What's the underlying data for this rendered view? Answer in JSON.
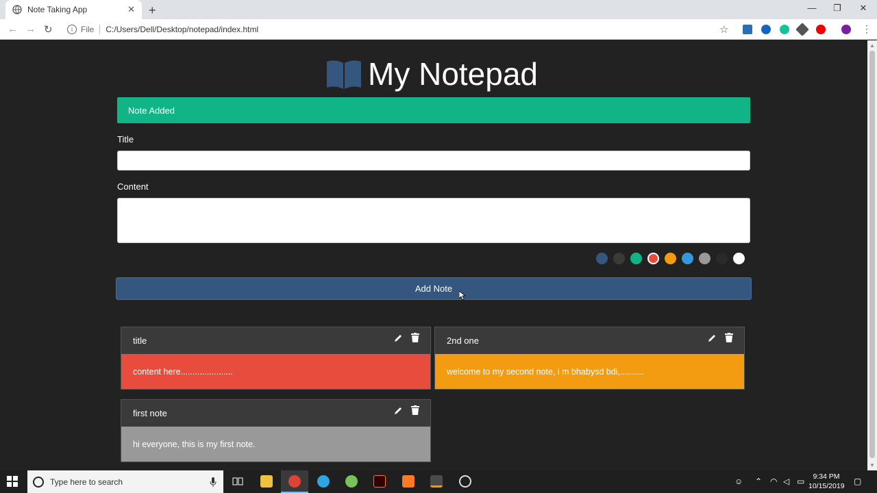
{
  "browser": {
    "tab_title": "Note Taking App",
    "tab_close": "✕",
    "new_tab": "+",
    "back": "←",
    "forward": "→",
    "reload": "↻",
    "info_glyph": "i",
    "file_label": "File",
    "url": "C:/Users/Dell/Desktop/notepad/index.html",
    "star": "☆",
    "menu": "⋮",
    "minimize": "—",
    "restore": "❐",
    "close": "✕"
  },
  "app": {
    "title": "My Notepad",
    "alert": "Note Added",
    "title_label": "Title",
    "content_label": "Content",
    "add_button": "Add Note",
    "colors": [
      "#34567f",
      "#3a3a3a",
      "#11b487",
      "#e74c3c",
      "#f39c12",
      "#3498db",
      "#999999",
      "#2a2a2a",
      "#ffffff"
    ],
    "selected_color": "#e74c3c"
  },
  "notes": [
    {
      "title": "title",
      "content": "content here......................",
      "color": "#e74c3c"
    },
    {
      "title": "2nd one",
      "content": "welcome to my second note, i m bhabysd bdi,..........",
      "color": "#f39c12"
    },
    {
      "title": "first note",
      "content": "hi everyone, this is my first note.",
      "color": "#999999"
    }
  ],
  "taskbar": {
    "search_placeholder": "Type here to search",
    "time": "9:34 PM",
    "date": "10/15/2019"
  }
}
